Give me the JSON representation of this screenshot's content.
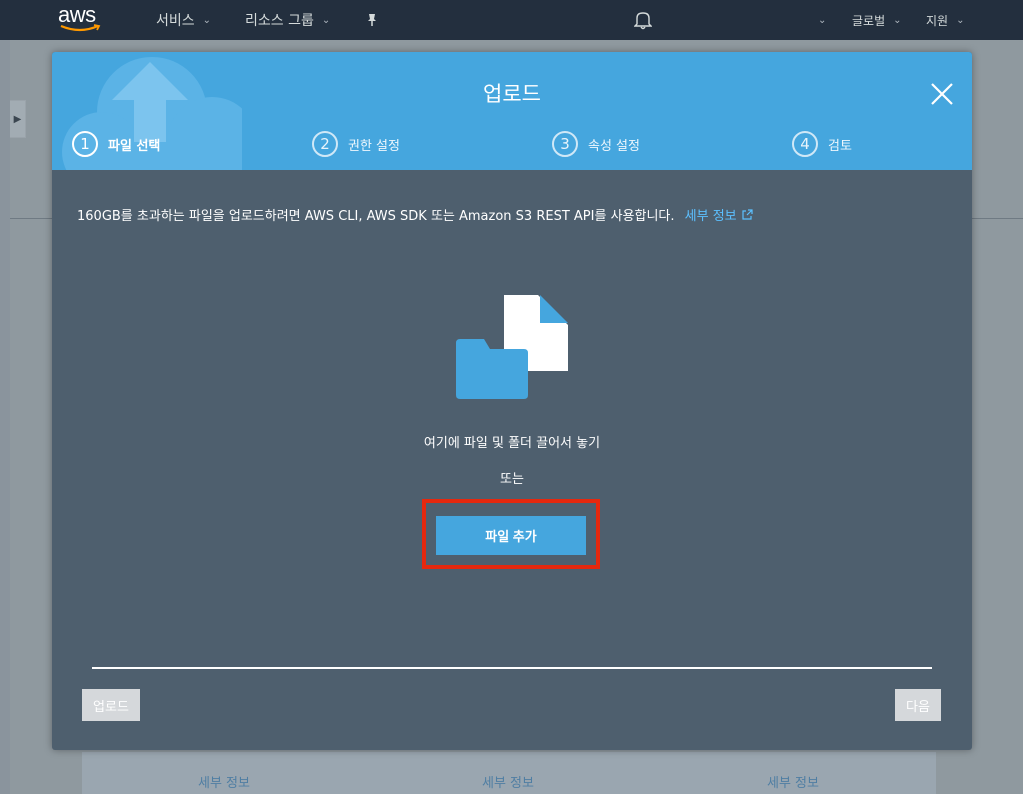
{
  "nav": {
    "logo_text": "aws",
    "services": "서비스",
    "resource_groups": "리소스 그룹",
    "region": "글로벌",
    "support": "지원"
  },
  "background": {
    "footer_links": [
      "세부 정보",
      "세부 정보",
      "세부 정보"
    ]
  },
  "modal": {
    "title": "업로드",
    "steps": [
      {
        "num": "1",
        "label": "파일 선택"
      },
      {
        "num": "2",
        "label": "권한 설정"
      },
      {
        "num": "3",
        "label": "속성 설정"
      },
      {
        "num": "4",
        "label": "검토"
      }
    ],
    "info_text": "160GB를 초과하는 파일을 업로드하려면 AWS CLI, AWS SDK 또는 Amazon S3 REST API를 사용합니다.",
    "info_link": "세부 정보",
    "drop_text": "여기에 파일 및 폴더 끌어서 놓기",
    "or_text": "또는",
    "add_files_button": "파일 추가",
    "upload_button": "업로드",
    "next_button": "다음"
  },
  "colors": {
    "nav_bg": "#232f3e",
    "header_blue": "#45a6de",
    "modal_body": "#4e5f6e",
    "highlight_red": "#e5280e",
    "link_blue": "#5cc0ff"
  },
  "icons": {
    "notifications": "bell-icon",
    "pin": "pin-icon",
    "close": "close-icon",
    "external_link": "external-link-icon",
    "drop_zone": "file-folder-icon"
  }
}
